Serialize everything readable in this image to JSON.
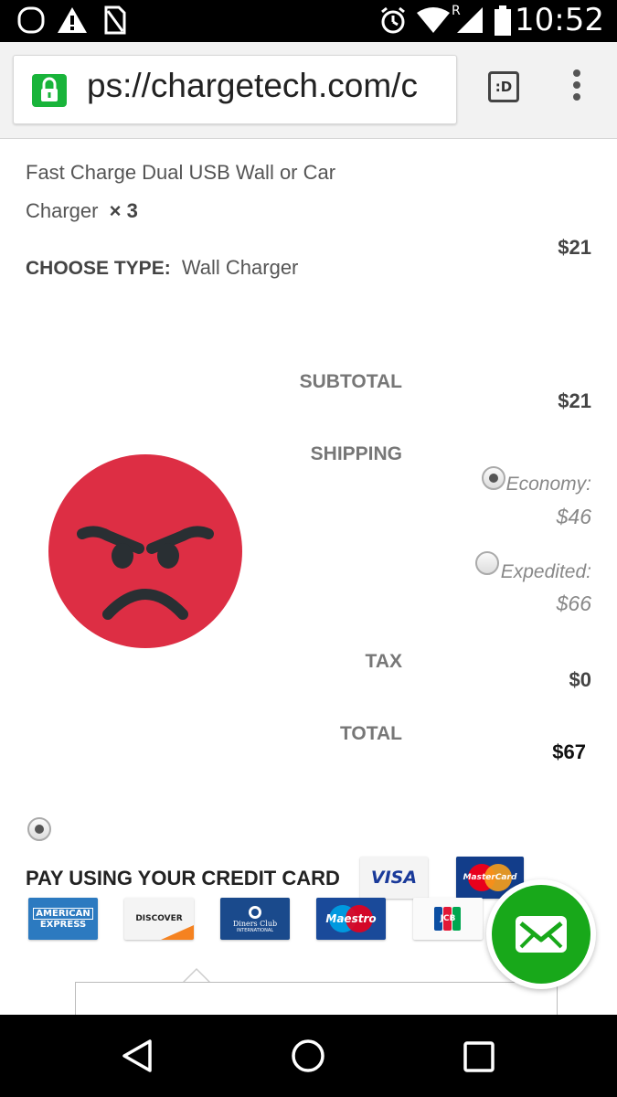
{
  "status_bar": {
    "time": "10:52",
    "icons": [
      "notification-ring-icon",
      "warning-icon",
      "no-sim-icon",
      "alarm-icon",
      "wifi-icon",
      "signal-roaming-icon",
      "battery-icon"
    ],
    "roaming_letter": "R"
  },
  "browser": {
    "url_display": "ps://chargetech.com/c",
    "tabs_label": ":D",
    "lock_color": "#19b43a"
  },
  "cart": {
    "product_name": "Fast Charge Dual USB Wall or Car Charger",
    "quantity": "× 3",
    "choose_label": "CHOOSE TYPE:",
    "choose_value": "Wall Charger",
    "line_price": "$21"
  },
  "summary": {
    "subtotal_label": "SUBTOTAL",
    "subtotal_value": "$21",
    "shipping_label": "SHIPPING",
    "shipping_options": [
      {
        "label": "Economy:",
        "price": "$46",
        "selected": true
      },
      {
        "label": "Expedited:",
        "price": "$66",
        "selected": false
      }
    ],
    "tax_label": "TAX",
    "tax_value": "$0",
    "total_label": "TOTAL",
    "total_value": "$67"
  },
  "payment": {
    "title": "PAY USING YOUR CREDIT CARD",
    "selected": true,
    "cards": {
      "visa": "VISA",
      "mastercard": "MasterCard",
      "amex_line1": "AMERICAN",
      "amex_line2": "EXPRESS",
      "discover": "DISCOVER",
      "diners_line1": "Diners Club",
      "diners_line2": "INTERNATIONAL",
      "maestro": "Maestro",
      "jcb": "JCB"
    }
  },
  "colors": {
    "emoji_red": "#dd2e44",
    "fab_green": "#18a81a",
    "amex_blue": "#2c7ac0",
    "diners_blue": "#1a4a8c",
    "maestro_blue": "#1a4a9a",
    "mastercard_navy": "#123d8a"
  },
  "navigation": [
    "back-icon",
    "home-icon",
    "recents-icon"
  ]
}
